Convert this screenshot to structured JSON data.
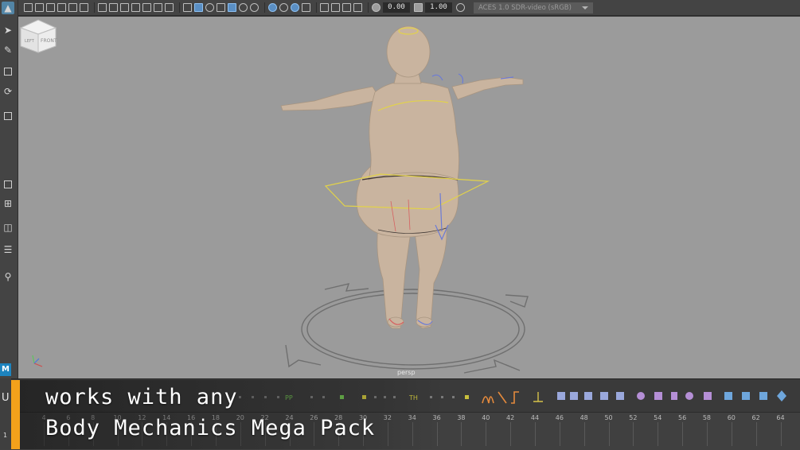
{
  "toolbar": {
    "time_value": "0.00",
    "gamma_value": "1.00",
    "color_space": "ACES 1.0 SDR-video (sRGB)"
  },
  "viewport": {
    "camera_name": "persp",
    "viewcube_faces": {
      "left": "LEFT",
      "front": "FRONT"
    },
    "axis_indicator": [
      "x",
      "y",
      "z"
    ]
  },
  "animation_strip": {
    "markers": [
      "PP",
      "TH"
    ]
  },
  "timeline": {
    "current_frame": "1",
    "ticks": [
      "4",
      "6",
      "8",
      "10",
      "12",
      "14",
      "16",
      "18",
      "20",
      "22",
      "24",
      "26",
      "28",
      "30",
      "32",
      "34",
      "36",
      "38",
      "40",
      "42",
      "44",
      "46",
      "48",
      "50",
      "52",
      "54",
      "56",
      "58",
      "60",
      "62",
      "64"
    ]
  },
  "caption": {
    "line1": "works with any",
    "line2": "Body Mechanics Mega Pack"
  },
  "colors": {
    "viewport_bg": "#9b9b9b",
    "accent_orange": "#f3a11b",
    "maya_blue": "#1d84bf",
    "skin": "#c9b49f"
  }
}
